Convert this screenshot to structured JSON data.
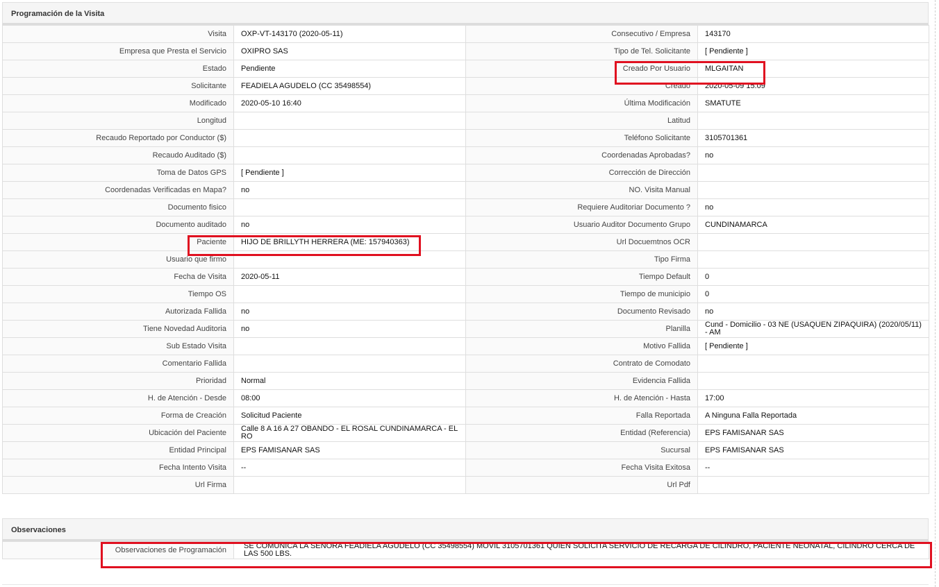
{
  "programacion": {
    "title": "Programación de la Visita",
    "rows": [
      {
        "l1": "Visita",
        "v1": "OXP-VT-143170 (2020-05-11)",
        "l2": "Consecutivo / Empresa",
        "v2": "143170"
      },
      {
        "l1": "Empresa que Presta el Servicio",
        "v1": "OXIPRO SAS",
        "l2": "Tipo de Tel. Solicitante",
        "v2": "[ Pendiente ]"
      },
      {
        "l1": "Estado",
        "v1": "Pendiente",
        "l2": "Creado Por Usuario",
        "v2": "MLGAITAN"
      },
      {
        "l1": "Solicitante",
        "v1": "FEADIELA AGUDELO (CC 35498554)",
        "l2": "Creado",
        "v2": "2020-05-09 15:09"
      },
      {
        "l1": "Modificado",
        "v1": "2020-05-10 16:40",
        "l2": "Última Modificación",
        "v2": "SMATUTE"
      },
      {
        "l1": "Longitud",
        "v1": "",
        "l2": "Latitud",
        "v2": ""
      },
      {
        "l1": "Recaudo Reportado por Conductor ($)",
        "v1": "",
        "l2": "Teléfono Solicitante",
        "v2": "3105701361"
      },
      {
        "l1": "Recaudo Auditado ($)",
        "v1": "",
        "l2": "Coordenadas Aprobadas?",
        "v2": "no"
      },
      {
        "l1": "Toma de Datos GPS",
        "v1": "[ Pendiente ]",
        "l2": "Corrección de Dirección",
        "v2": ""
      },
      {
        "l1": "Coordenadas Verificadas en Mapa?",
        "v1": "no",
        "l2": "NO. Visita Manual",
        "v2": ""
      },
      {
        "l1": "Documento fisico",
        "v1": "",
        "l2": "Requiere Auditoriar Documento ?",
        "v2": "no"
      },
      {
        "l1": "Documento auditado",
        "v1": "no",
        "l2": "Usuario Auditor Documento Grupo",
        "v2": "CUNDINAMARCA"
      },
      {
        "l1": "Paciente",
        "v1": "HIJO DE BRILLYTH HERRERA (ME: 157940363)",
        "l2": "Url Docuemtnos OCR",
        "v2": ""
      },
      {
        "l1": "Usuario que firmo",
        "v1": "",
        "l2": "Tipo Firma",
        "v2": ""
      },
      {
        "l1": "Fecha de Visita",
        "v1": "2020-05-11",
        "l2": "Tiempo Default",
        "v2": "0"
      },
      {
        "l1": "Tiempo OS",
        "v1": "",
        "l2": "Tiempo de municipio",
        "v2": "0"
      },
      {
        "l1": "Autorizada Fallida",
        "v1": "no",
        "l2": "Documento Revisado",
        "v2": "no"
      },
      {
        "l1": "Tiene Novedad Auditoria",
        "v1": "no",
        "l2": "Planilla",
        "v2": "Cund - Domicilio - 03 NE (USAQUEN ZIPAQUIRA) (2020/05/11) - AM"
      },
      {
        "l1": "Sub Estado Visita",
        "v1": "",
        "l2": "Motivo Fallida",
        "v2": "[ Pendiente ]"
      },
      {
        "l1": "Comentario Fallida",
        "v1": "",
        "l2": "Contrato de Comodato",
        "v2": ""
      },
      {
        "l1": "Prioridad",
        "v1": "Normal",
        "l2": "Evidencia Fallida",
        "v2": ""
      },
      {
        "l1": "H. de Atención - Desde",
        "v1": "08:00",
        "l2": "H. de Atención - Hasta",
        "v2": "17:00"
      },
      {
        "l1": "Forma de Creación",
        "v1": "Solicitud Paciente",
        "l2": "Falla Reportada",
        "v2": "A Ninguna Falla Reportada"
      },
      {
        "l1": "Ubicación del Paciente",
        "v1": "Calle 8 A 16 A 27 OBANDO - EL ROSAL CUNDINAMARCA - EL RO",
        "l2": "Entidad (Referencia)",
        "v2": "EPS FAMISANAR SAS"
      },
      {
        "l1": "Entidad Principal",
        "v1": "EPS FAMISANAR SAS",
        "l2": "Sucursal",
        "v2": "EPS FAMISANAR SAS"
      },
      {
        "l1": "Fecha Intento Visita",
        "v1": "--",
        "l2": "Fecha Visita Exitosa",
        "v2": "--"
      },
      {
        "l1": "Url Firma",
        "v1": "",
        "l2": "Url Pdf",
        "v2": ""
      }
    ]
  },
  "observaciones": {
    "title": "Observaciones",
    "label": "Observaciones de Programación",
    "value": "SE COMUNICA LA SEÑORA FEADIELA AGUDELO (CC 35498554) MOVIL 3105701361 QUIEN SOLICITA SERVICIO DE RECARGA DE CILINDRO, PACIENTE NEONATAL, CILINDRO CERCA DE LAS 500 LBS."
  },
  "colors": {
    "highlight": "#e01020",
    "header_bg": "#f5f5f5",
    "label_bg": "#fafafa",
    "border": "#dedede"
  }
}
